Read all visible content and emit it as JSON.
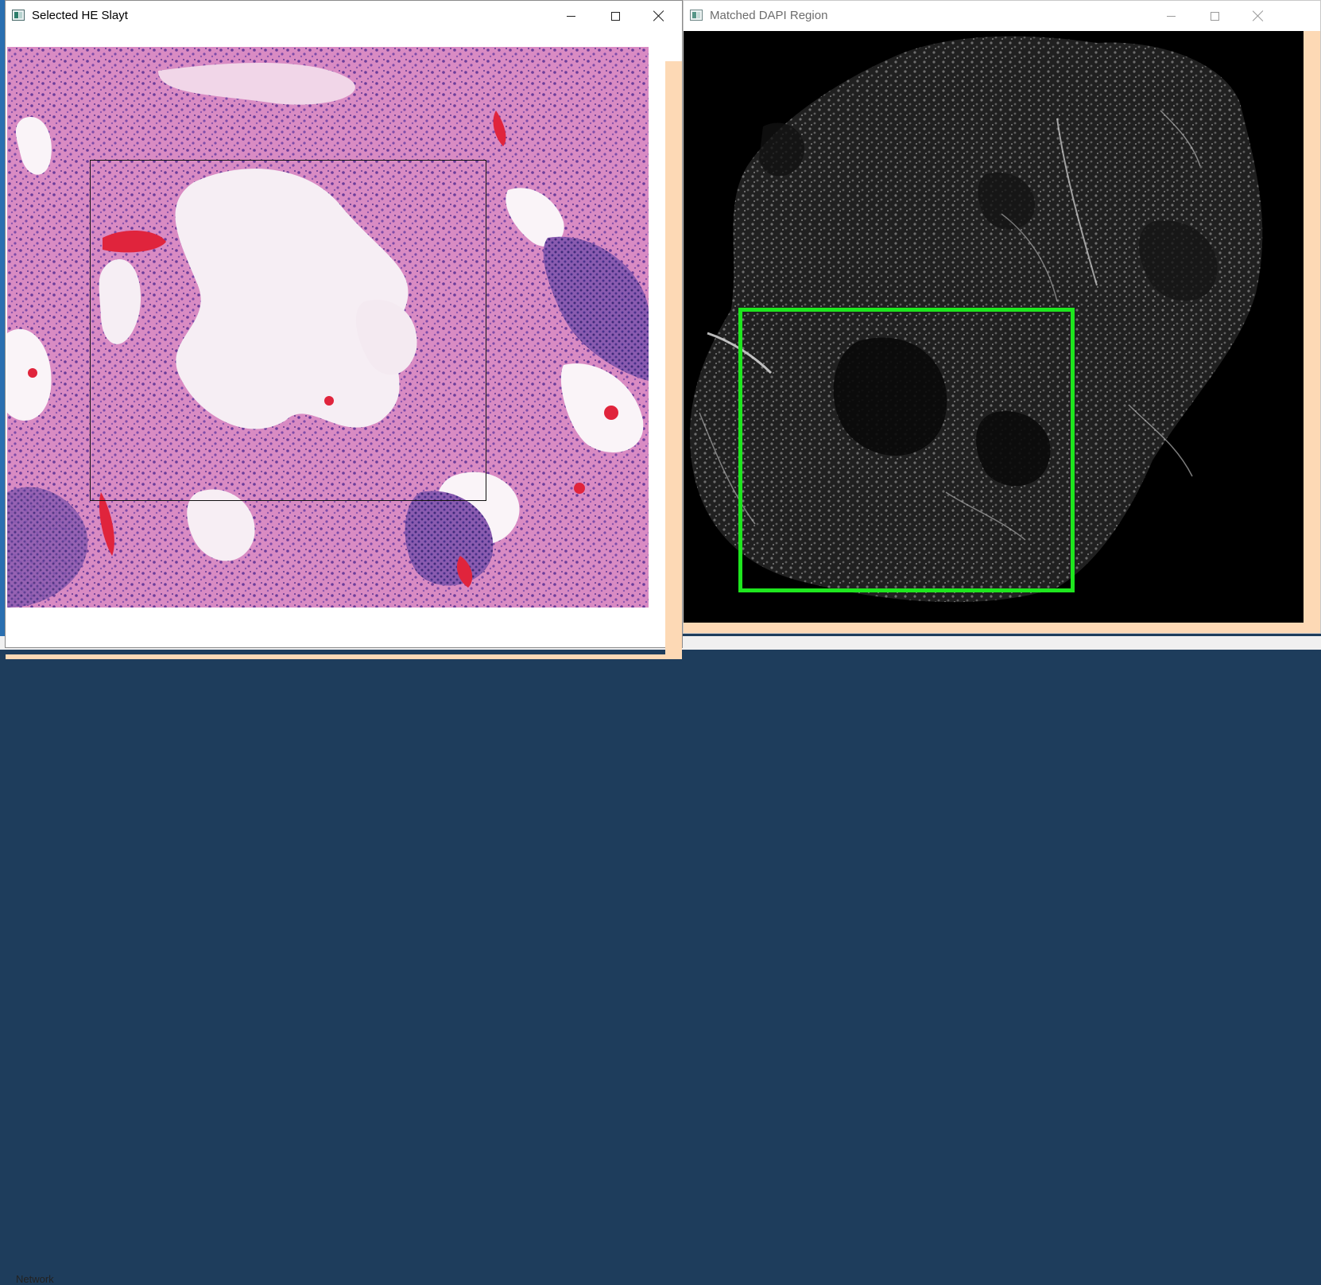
{
  "desktop": {
    "taskbar_text": "Network"
  },
  "windows": {
    "he": {
      "title": "Selected HE Slayt",
      "controls": {
        "minimize": "minimize",
        "maximize": "maximize",
        "close": "close"
      }
    },
    "dapi": {
      "title": "Matched DAPI Region",
      "controls": {
        "minimize": "minimize",
        "maximize": "maximize",
        "close": "close"
      }
    }
  },
  "colors": {
    "canvas_background": "#fdd9b5",
    "match_box": "#1ee61e",
    "selection_box": "#111111",
    "he_tissue_pink": "#e48fc0",
    "he_tissue_purple": "#7d4fa6",
    "he_blood_red": "#e0243c",
    "dapi_nuclei": "#c8c8c8"
  }
}
